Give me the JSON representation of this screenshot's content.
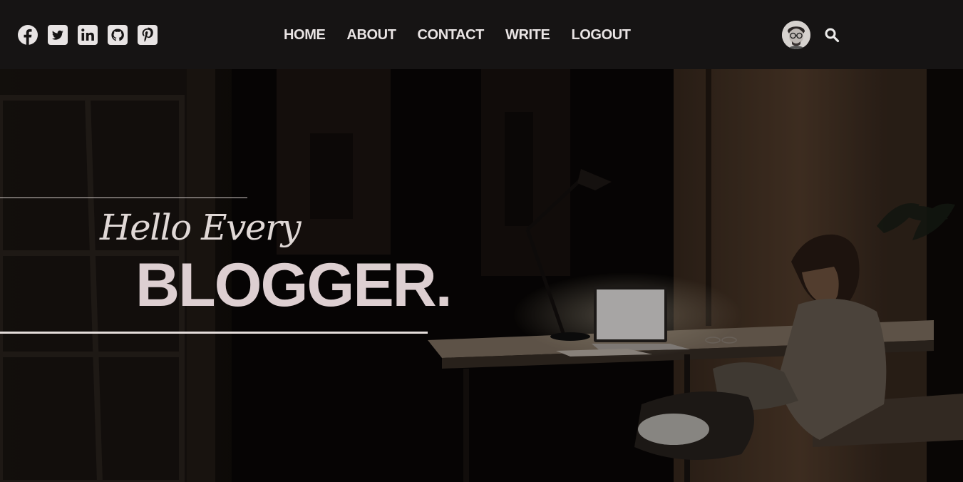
{
  "social": [
    {
      "name": "facebook-icon"
    },
    {
      "name": "twitter-icon"
    },
    {
      "name": "linkedin-icon"
    },
    {
      "name": "github-icon"
    },
    {
      "name": "pinterest-icon"
    }
  ],
  "nav": {
    "items": [
      {
        "label": "HOME"
      },
      {
        "label": "ABOUT"
      },
      {
        "label": "CONTACT"
      },
      {
        "label": "WRITE"
      },
      {
        "label": "LOGOUT"
      }
    ]
  },
  "hero": {
    "greeting": "Hello Every",
    "headline": "BLOGGER."
  },
  "colors": {
    "topbar": "#161414",
    "nav_text": "#e9e4e4",
    "headline": "#ddcfd1"
  }
}
